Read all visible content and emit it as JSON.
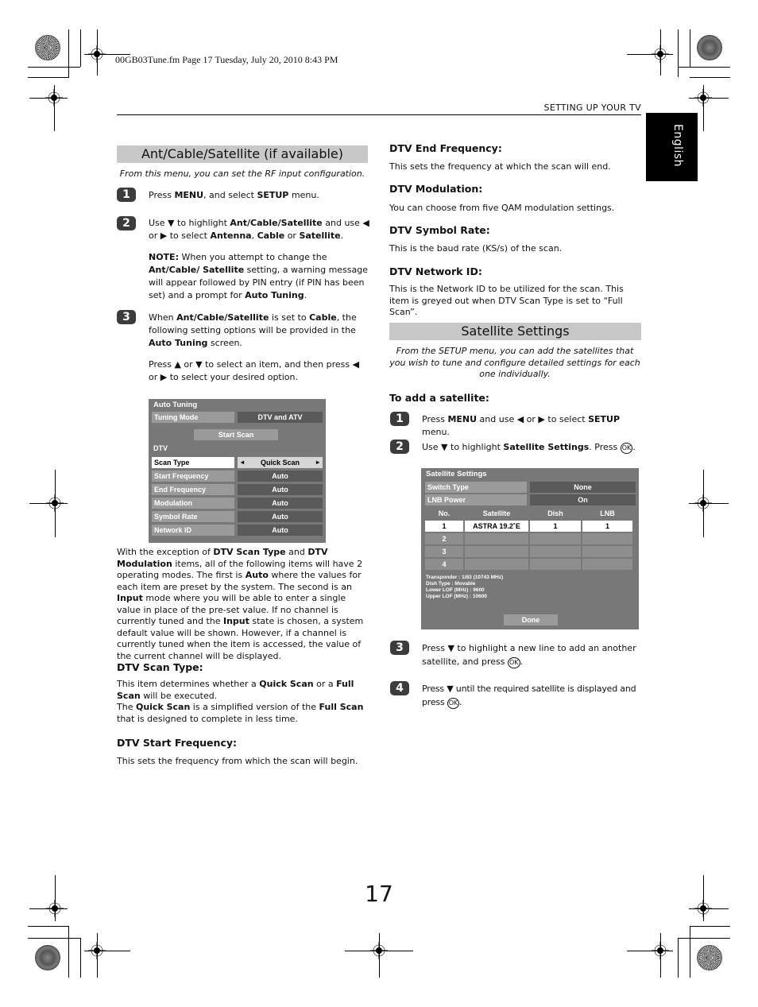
{
  "header": {
    "file_info": "00GB03Tune.fm  Page 17  Tuesday, July 20, 2010  8:43 PM",
    "running_head": "SETTING UP YOUR TV",
    "language_tab": "English"
  },
  "left": {
    "section_title": "Ant/Cable/Satellite (if available)",
    "intro": "From this menu, you can set the RF input configuration.",
    "steps": [
      {
        "num": "1",
        "html": "Press <b>MENU</b>, and select <b>SETUP</b> menu."
      },
      {
        "num": "2",
        "html": "Use &#9660; to highlight <b>Ant/Cable/Satellite</b> and use &#9664; or &#9654; to select <b>Antenna</b>, <b>Cable</b> or <b>Satellite</b>."
      },
      {
        "num": "3",
        "html": "When <b>Ant/Cable/Satellite</b> is set to <b>Cable</b>, the following setting options will be provided in the <b>Auto Tuning</b> screen."
      }
    ],
    "note": "<b>NOTE:</b> When you attempt to change the <b>Ant/Cable/ Satellite</b> setting, a warning message will appear followed by PIN entry (if PIN has been set) and a prompt for <b>Auto Tuning</b>.",
    "step3_extra": "Press &#9650; or &#9660; to select an item, and then press &#9664; or &#9654; to select your desired option.",
    "auto_tuning_menu": {
      "title": "Auto Tuning",
      "tuning_mode_label": "Tuning Mode",
      "tuning_mode_value": "DTV and ATV",
      "start_scan": "Start Scan",
      "dtv_label": "DTV",
      "rows": [
        {
          "label": "Scan Type",
          "value": "Quick Scan",
          "selected": true
        },
        {
          "label": "Start Frequency",
          "value": "Auto"
        },
        {
          "label": "End Frequency",
          "value": "Auto"
        },
        {
          "label": "Modulation",
          "value": "Auto"
        },
        {
          "label": "Symbol Rate",
          "value": "Auto"
        },
        {
          "label": "Network ID",
          "value": "Auto"
        }
      ],
      "arrow_left": "◂",
      "arrow_right": "▸"
    },
    "body_paragraph": "With the exception of <b>DTV Scan Type</b> and <b>DTV Modulation</b> items, all of the following items will have 2 operating modes. The first is <b>Auto</b> where the values for each item are preset by the system. The second is an <b>Input</b> mode where you will be able to enter a single value in place of the pre-set value. If no channel is currently tuned and the <b>Input</b> state is chosen, a system default value will be shown. However, if a channel is currently tuned when the item is accessed, the value of the current channel will be displayed.",
    "scan_type_heading": "DTV Scan Type:",
    "scan_type_text": "This item determines whether a <b>Quick Scan</b> or a <b>Full Scan</b> will be executed.<br>The <b>Quick Scan</b> is a simplified version of the <b>Full Scan</b> that is designed to complete in less time.",
    "start_freq_heading": "DTV Start Frequency:",
    "start_freq_text": "This sets the frequency from which the scan will begin."
  },
  "right": {
    "end_freq_heading": "DTV End Frequency:",
    "end_freq_text": "This sets the frequency at which the scan will end.",
    "modulation_heading": "DTV Modulation:",
    "modulation_text": "You can choose from five QAM modulation settings.",
    "symbol_rate_heading": "DTV Symbol Rate:",
    "symbol_rate_text": "This is the baud rate (KS/s) of the scan.",
    "network_id_heading": "DTV Network ID:",
    "network_id_text": "This is the Network ID to be utilized for the scan. This item is greyed out when DTV Scan Type is set to “Full Scan”.",
    "section_title": "Satellite Settings",
    "intro": "From the SETUP menu, you can add the satellites that you wish to tune and configure detailed settings for each one individually.",
    "add_heading": "To add a satellite:",
    "steps": [
      {
        "num": "1",
        "html": "Press <b>MENU</b> and use &#9664; or &#9654; to select <b>SETUP</b> menu."
      },
      {
        "num": "2",
        "html": "Use &#9660; to highlight <b>Satellite Settings</b>. Press <span class=\"ok\">OK</span>."
      },
      {
        "num": "3",
        "html": "Press &#9660; to highlight a new line to add an another satellite, and press <span class=\"ok\">OK</span>."
      },
      {
        "num": "4",
        "html": "Press &#9660; until the required satellite is displayed and press <span class=\"ok\">OK</span>."
      }
    ],
    "satellite_menu": {
      "title": "Satellite Settings",
      "switch_type_label": "Switch Type",
      "switch_type_value": "None",
      "lnb_power_label": "LNB Power",
      "lnb_power_value": "On",
      "columns": [
        "No.",
        "Satellite",
        "Dish",
        "LNB"
      ],
      "rows": [
        {
          "no": "1",
          "satellite": "ASTRA 19.2˚E",
          "dish": "1",
          "lnb": "1"
        },
        {
          "no": "2",
          "satellite": "",
          "dish": "",
          "lnb": ""
        },
        {
          "no": "3",
          "satellite": "",
          "dish": "",
          "lnb": ""
        },
        {
          "no": "4",
          "satellite": "",
          "dish": "",
          "lnb": ""
        }
      ],
      "info": [
        "Transponder : 1/83 (10743 MHz)",
        "Dish Type : Movable",
        "Lower LOF (MHz) : 9600",
        "Upper LOF (MHz) : 10600"
      ],
      "done": "Done"
    }
  },
  "footer": {
    "page_number": "17"
  }
}
